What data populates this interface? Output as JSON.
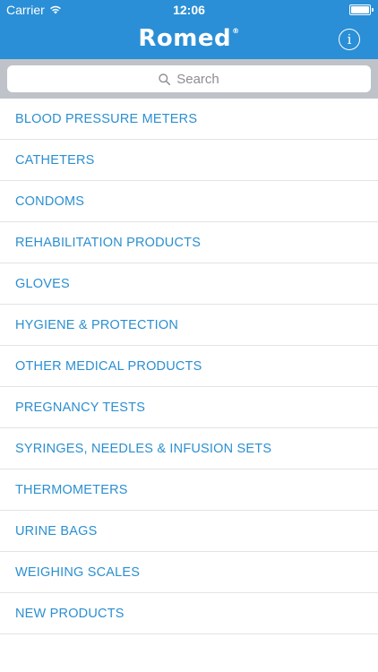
{
  "status_bar": {
    "carrier": "Carrier",
    "time": "12:06"
  },
  "nav": {
    "logo": "Romed",
    "registered_mark": "®",
    "info_icon": "info-icon",
    "info_glyph": "i"
  },
  "search": {
    "placeholder": "Search",
    "icon": "search-icon"
  },
  "categories": [
    {
      "label": "BLOOD PRESSURE METERS"
    },
    {
      "label": "CATHETERS"
    },
    {
      "label": "CONDOMS"
    },
    {
      "label": "REHABILITATION PRODUCTS"
    },
    {
      "label": "GLOVES"
    },
    {
      "label": "HYGIENE & PROTECTION"
    },
    {
      "label": "OTHER MEDICAL PRODUCTS"
    },
    {
      "label": "PREGNANCY TESTS"
    },
    {
      "label": "SYRINGES, NEEDLES & INFUSION SETS"
    },
    {
      "label": "THERMOMETERS"
    },
    {
      "label": "URINE BAGS"
    },
    {
      "label": "WEIGHING SCALES"
    },
    {
      "label": "NEW PRODUCTS"
    }
  ],
  "colors": {
    "brand": "#2a8fd6",
    "link": "#2b8fd0",
    "search_bar_bg": "#bfc3c9"
  }
}
